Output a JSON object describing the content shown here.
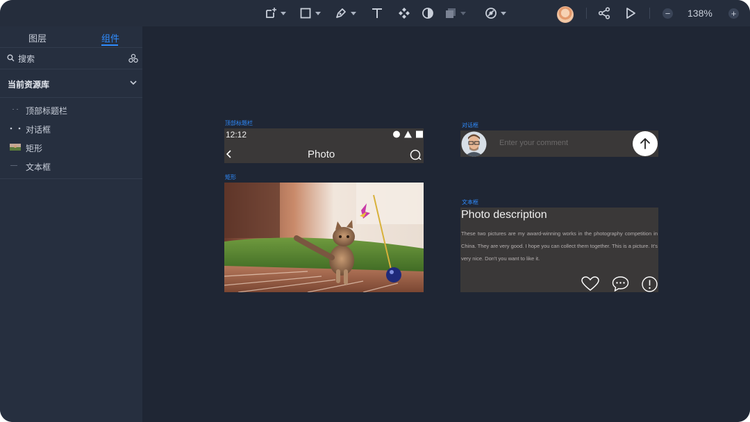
{
  "toolbar": {
    "zoom": "138%",
    "zoom_out": "−",
    "zoom_in": "+",
    "tools": [
      "frame-tool-icon",
      "rectangle-tool-icon",
      "pen-tool-icon",
      "text-tool-icon",
      "component-tool-icon",
      "mask-tool-icon",
      "boolean-tool-icon",
      "prototype-tool-icon"
    ]
  },
  "sidebar": {
    "tabs": [
      {
        "label": "图层"
      },
      {
        "label": "组件"
      }
    ],
    "active_tab": 1,
    "search_placeholder": "搜索",
    "library_title": "当前资源库",
    "items": [
      {
        "label": "顶部标题栏"
      },
      {
        "label": "对话框"
      },
      {
        "label": "矩形"
      },
      {
        "label": "文本框"
      }
    ]
  },
  "canvas": {
    "title_bar": {
      "caption": "顶部标题栏",
      "time": "12:12",
      "title": "Photo"
    },
    "rect": {
      "caption": "矩形"
    },
    "dialog": {
      "caption": "对话框",
      "placeholder": "Enter your comment"
    },
    "textbox": {
      "caption": "文本框",
      "title": "Photo description",
      "body": "These two pictures are my award-winning works in the photography competition in China. They are very good. I hope you can collect them together. This is a picture. It's very nice. Don't you want to like it."
    }
  },
  "colors": {
    "accent": "#2f8cff",
    "canvas_bg": "#1f2634",
    "sidebar_bg": "#262f3f",
    "component_bg": "#3a3838"
  }
}
